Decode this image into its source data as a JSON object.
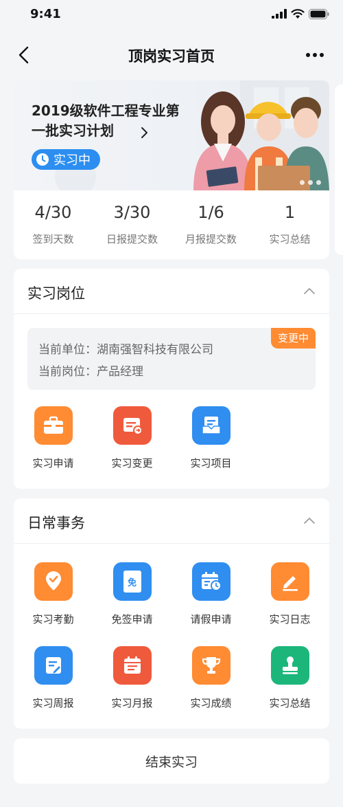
{
  "status": {
    "time": "9:41"
  },
  "nav": {
    "title": "顶岗实习首页"
  },
  "banner": {
    "title": "2019级软件工程专业第一批实习计划",
    "status": "实习中",
    "stats": [
      {
        "value": "4/30",
        "label": "签到天数"
      },
      {
        "value": "3/30",
        "label": "日报提交数"
      },
      {
        "value": "1/6",
        "label": "月报提交数"
      },
      {
        "value": "1",
        "label": "实习总结"
      }
    ]
  },
  "job_section": {
    "title": "实习岗位",
    "company_line": "当前单位：湖南强智科技有限公司",
    "position_line": "当前岗位：产品经理",
    "badge": "变更中",
    "actions": [
      {
        "label": "实习申请",
        "icon": "briefcase-icon",
        "color": "#ff8b33"
      },
      {
        "label": "实习变更",
        "icon": "change-doc-icon",
        "color": "#ef5a3c"
      },
      {
        "label": "实习项目",
        "icon": "project-doc-icon",
        "color": "#2f8ef0"
      }
    ]
  },
  "daily_section": {
    "title": "日常事务",
    "actions": [
      {
        "label": "实习考勤",
        "icon": "location-check-icon",
        "color": "#ff8b33"
      },
      {
        "label": "免签申请",
        "icon": "exempt-doc-icon",
        "color": "#2f8ef0"
      },
      {
        "label": "请假申请",
        "icon": "calendar-clock-icon",
        "color": "#2f8ef0"
      },
      {
        "label": "实习日志",
        "icon": "pencil-icon",
        "color": "#ff8b33"
      },
      {
        "label": "实习周报",
        "icon": "weekly-report-icon",
        "color": "#2f8ef0"
      },
      {
        "label": "实习月报",
        "icon": "monthly-calendar-icon",
        "color": "#ef5a3c"
      },
      {
        "label": "实习成绩",
        "icon": "trophy-icon",
        "color": "#ff8b33"
      },
      {
        "label": "实习总结",
        "icon": "stamp-icon",
        "color": "#1cb67b"
      }
    ],
    "icon_text": {
      "exempt": "免"
    }
  },
  "footer": {
    "end_button": "结束实习"
  }
}
